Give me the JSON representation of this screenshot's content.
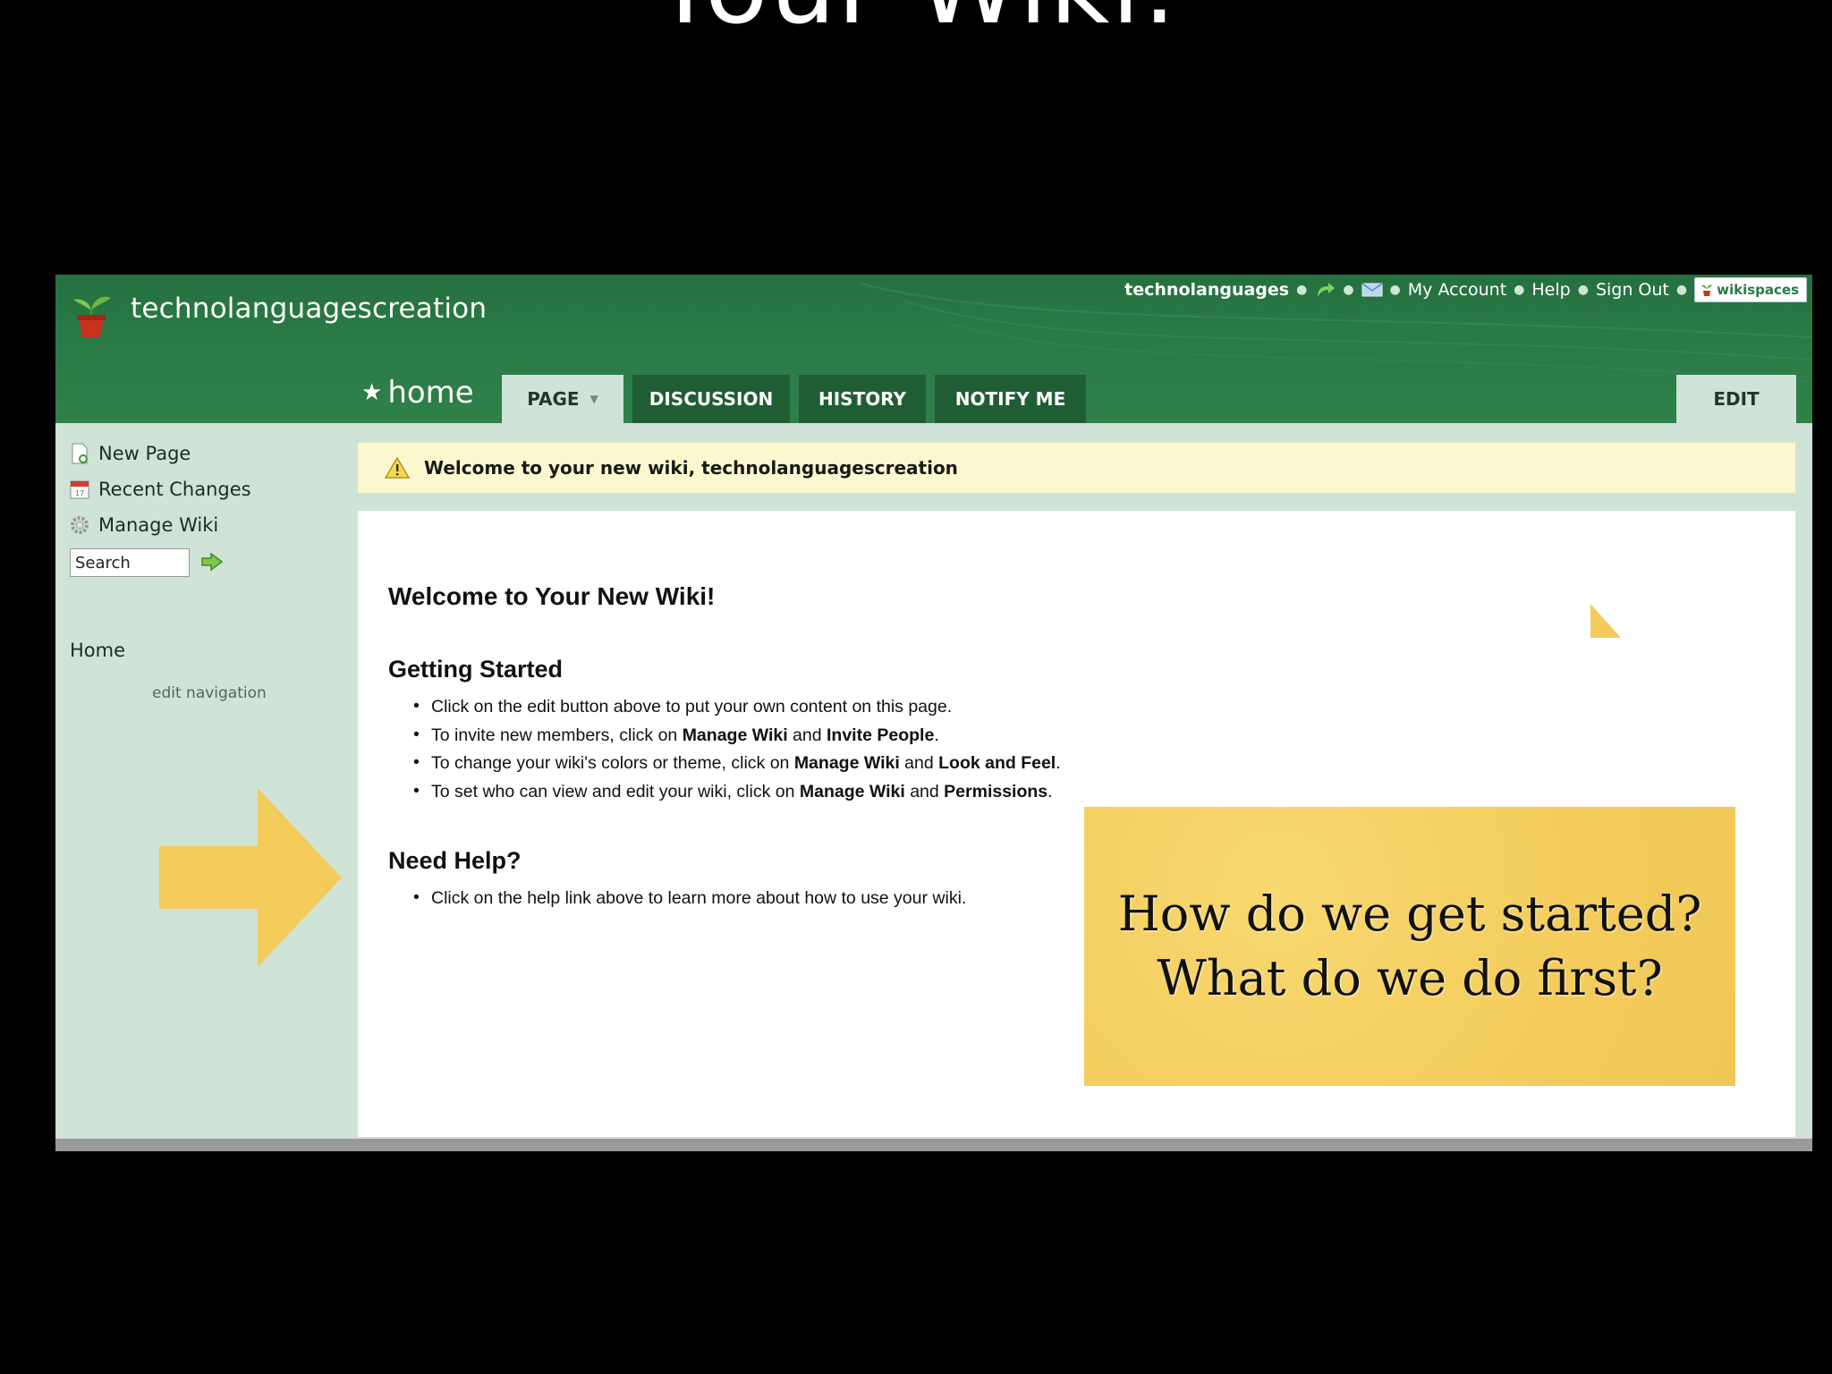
{
  "slide": {
    "title": "Your Wiki:"
  },
  "site": {
    "name": "technolanguagescreation"
  },
  "topbar": {
    "username": "technolanguages",
    "my_account": "My Account",
    "help": "Help",
    "sign_out": "Sign Out",
    "badge": "wikispaces"
  },
  "page": {
    "name": "home",
    "tabs": {
      "page": "PAGE",
      "discussion": "DISCUSSION",
      "history": "HISTORY",
      "notify": "NOTIFY ME",
      "edit": "EDIT"
    }
  },
  "sidebar": {
    "new_page": "New Page",
    "recent_changes": "Recent Changes",
    "manage_wiki": "Manage Wiki",
    "search_value": "Search",
    "nav_home": "Home",
    "edit_navigation": "edit navigation"
  },
  "notice": {
    "text": "Welcome to your new wiki, technolanguagescreation"
  },
  "content": {
    "heading": "Welcome to Your New Wiki!",
    "getting_started": {
      "heading": "Getting Started",
      "b1": "Click on the edit button above to put your own content on this page.",
      "b2_pre": "To invite new members, click on ",
      "b2_b1": "Manage Wiki",
      "b2_mid": " and ",
      "b2_b2": "Invite People",
      "b2_end": ".",
      "b3_pre": "To change your wiki's colors or theme, click on ",
      "b3_b1": "Manage Wiki",
      "b3_mid": " and ",
      "b3_b2": "Look and Feel",
      "b3_end": ".",
      "b4_pre": "To set who can view and edit your wiki, click on ",
      "b4_b1": "Manage Wiki",
      "b4_mid": " and ",
      "b4_b2": "Permissions",
      "b4_end": "."
    },
    "need_help": {
      "heading": "Need Help?",
      "b1": "Click on the help link above to learn more about how to use your wiki."
    }
  },
  "callout": {
    "line1": "How do we get started?",
    "line2": "What do we do first?"
  },
  "colors": {
    "banner": "#2a7a46",
    "sidebar": "#cfe3d6",
    "notice": "#fbf8cf",
    "callout": "#f5d063"
  }
}
